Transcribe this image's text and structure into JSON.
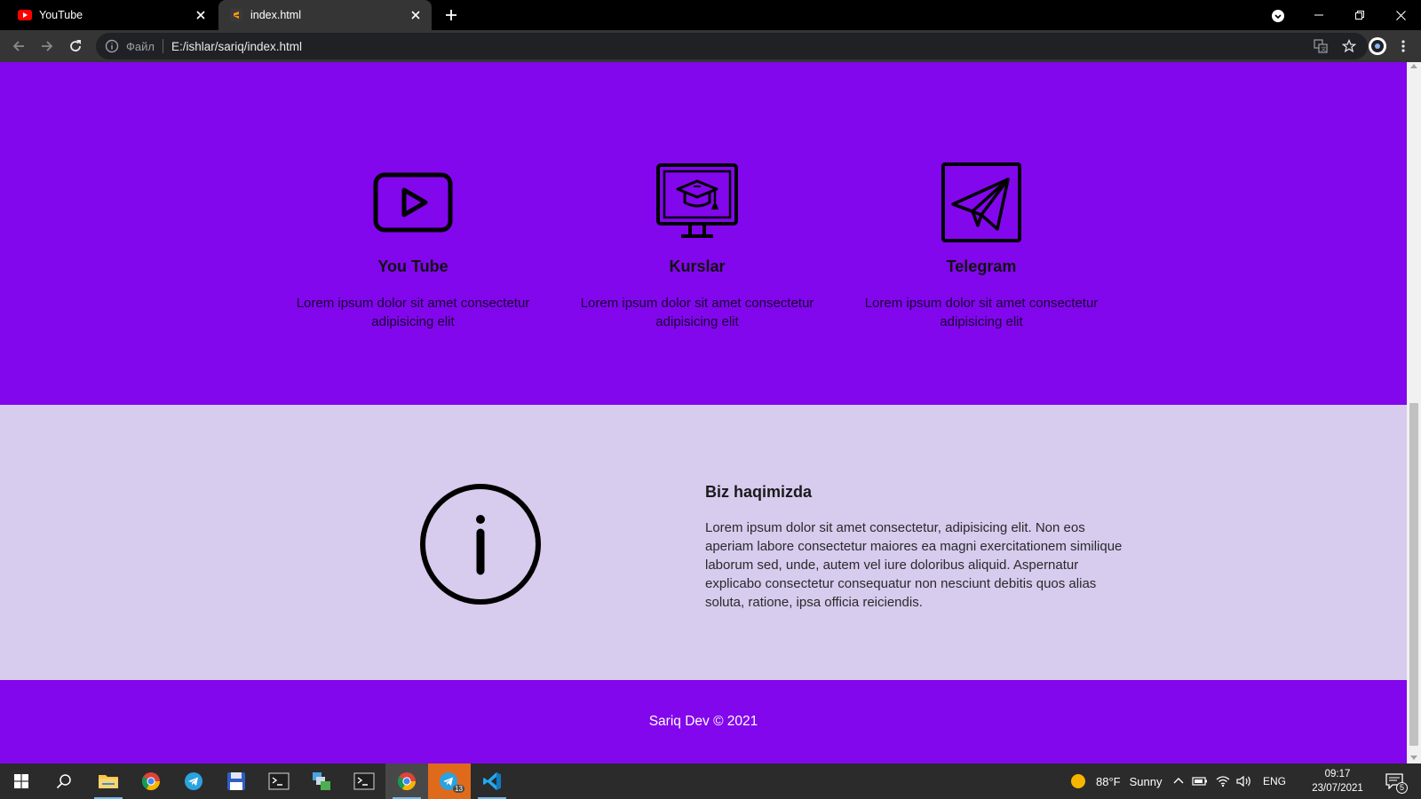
{
  "browser": {
    "tabs": [
      {
        "title": "YouTube",
        "icon": "youtube-icon"
      },
      {
        "title": "index.html",
        "icon": "sublime-icon"
      }
    ],
    "address": {
      "scheme_label": "Файл",
      "url": "E:/ishlar/sariq/index.html"
    }
  },
  "page": {
    "services": [
      {
        "title": "You Tube",
        "text": "Lorem ipsum dolor sit amet consectetur adipisicing elit",
        "icon": "youtube-play-icon"
      },
      {
        "title": "Kurslar",
        "text": "Lorem ipsum dolor sit amet consectetur adipisicing elit",
        "icon": "monitor-graduation-cap-icon"
      },
      {
        "title": "Telegram",
        "text": "Lorem ipsum dolor sit amet consectetur adipisicing elit",
        "icon": "telegram-plane-icon"
      }
    ],
    "about": {
      "title": "Biz haqimizda",
      "text": "Lorem ipsum dolor sit amet consectetur, adipisicing elit. Non eos aperiam labore consectetur maiores ea magni exercitationem similique laborum sed, unde, autem vel iure doloribus aliquid. Aspernatur explicabo consectetur consequatur non nesciunt debitis quos alias soluta, ratione, ipsa officia reiciendis.",
      "icon": "info-circle-icon"
    },
    "footer": {
      "text": "Sariq Dev © 2021"
    },
    "colors": {
      "primary": "#8207ec",
      "about_bg": "#d7cbee"
    }
  },
  "taskbar": {
    "weather": {
      "temp": "88°F",
      "condition": "Sunny"
    },
    "language": "ENG",
    "time": "09:17",
    "date": "23/07/2021",
    "notification_count": "5",
    "telegram_badge": "13"
  }
}
